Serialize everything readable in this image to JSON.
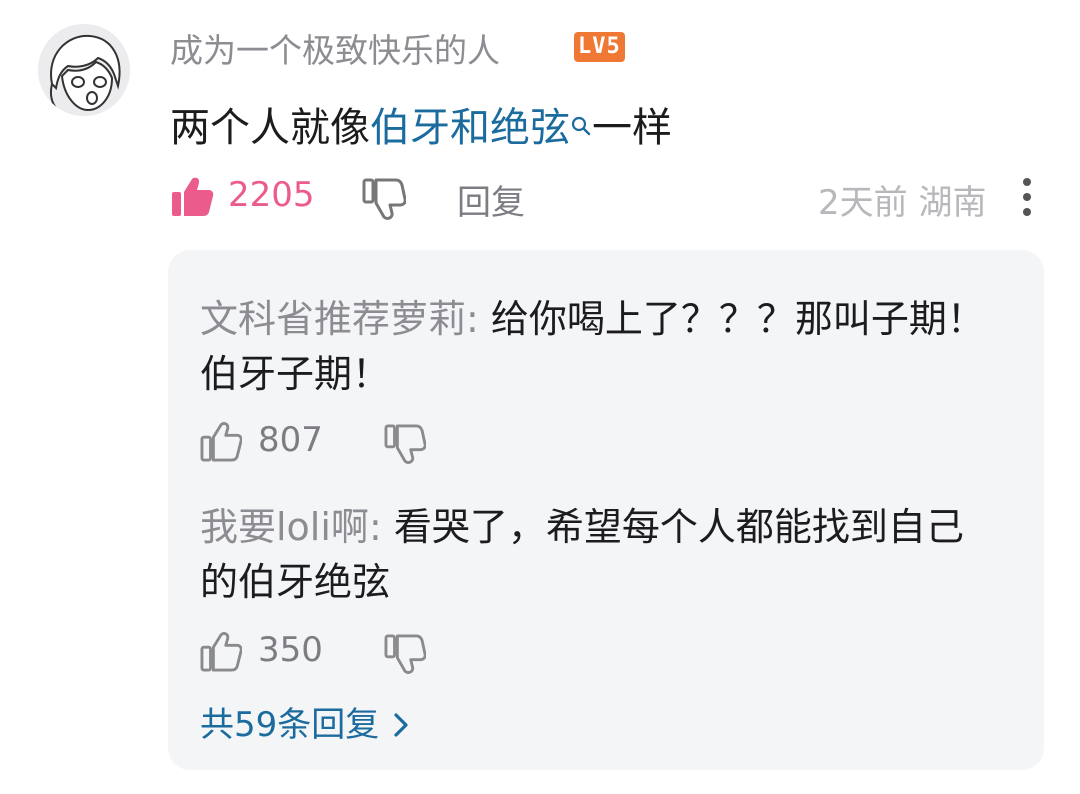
{
  "comment": {
    "username": "成为一个极致快乐的人",
    "level_badge": "LV5",
    "text_before": "两个人就像",
    "link_text": "伯牙和绝弦",
    "text_after": "一样",
    "likes": "2205",
    "reply_label": "回复",
    "time_location": "2天前 湖南"
  },
  "replies": [
    {
      "user": "文科省推荐萝莉",
      "separator": ": ",
      "text": "给你喝上了？？？那叫子期！伯牙子期！",
      "likes": "807"
    },
    {
      "user": "我要loli啊",
      "separator": ": ",
      "text": "看哭了，希望每个人都能找到自己的伯牙绝弦",
      "likes": "350"
    }
  ],
  "more_replies_label": "共59条回复",
  "colors": {
    "link": "#1b6b9e",
    "like_active": "#eb5c8d",
    "muted": "#8c8c92",
    "reply_bg": "#f4f5f7"
  },
  "icons": [
    "avatar",
    "thumbs-up-icon",
    "thumbs-down-icon",
    "more-vertical-icon",
    "search-icon",
    "chevron-right-icon"
  ]
}
